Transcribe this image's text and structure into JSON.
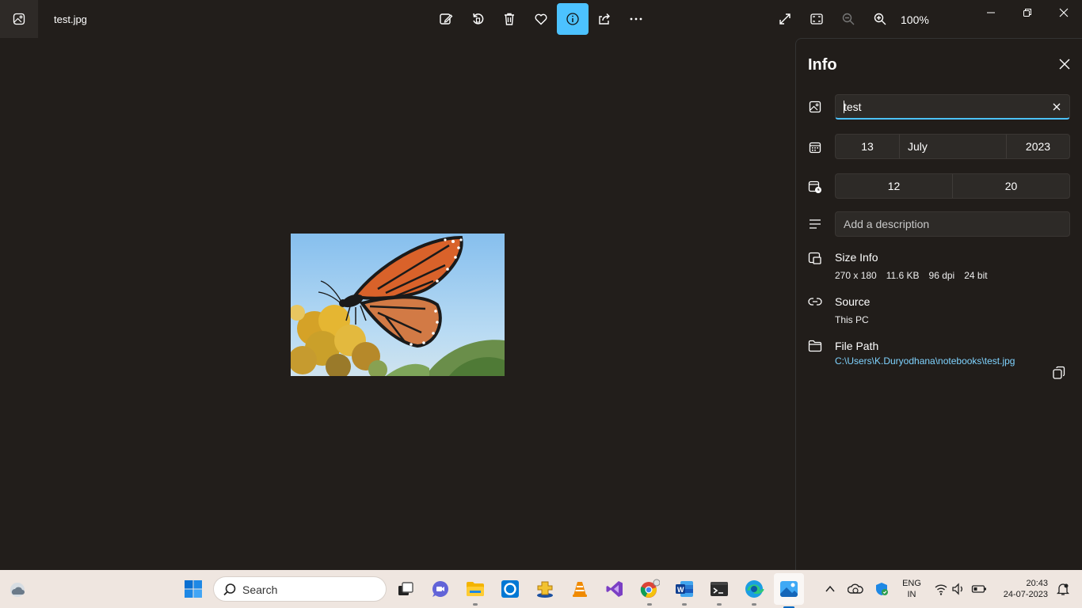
{
  "titlebar": {
    "filename": "test.jpg",
    "zoom": "100%"
  },
  "info": {
    "title": "Info",
    "name_value": "test",
    "date": {
      "day": "13",
      "month": "July",
      "year": "2023"
    },
    "time": {
      "hour": "12",
      "minute": "20"
    },
    "description_placeholder": "Add a description",
    "size": {
      "title": "Size Info",
      "dimensions": "270 x 180",
      "filesize": "11.6 KB",
      "dpi": "96 dpi",
      "bitdepth": "24 bit"
    },
    "source": {
      "title": "Source",
      "value": "This PC"
    },
    "filepath": {
      "title": "File Path",
      "value": "C:\\Users\\K.Duryodhana\\notebooks\\test.jpg"
    }
  },
  "taskbar": {
    "search_label": "Search",
    "lang_line1": "ENG",
    "lang_line2": "IN",
    "time": "20:43",
    "date": "24-07-2023"
  },
  "colors": {
    "accent": "#4cc2ff",
    "background": "#221e1b",
    "taskbar": "#efe6e0"
  }
}
